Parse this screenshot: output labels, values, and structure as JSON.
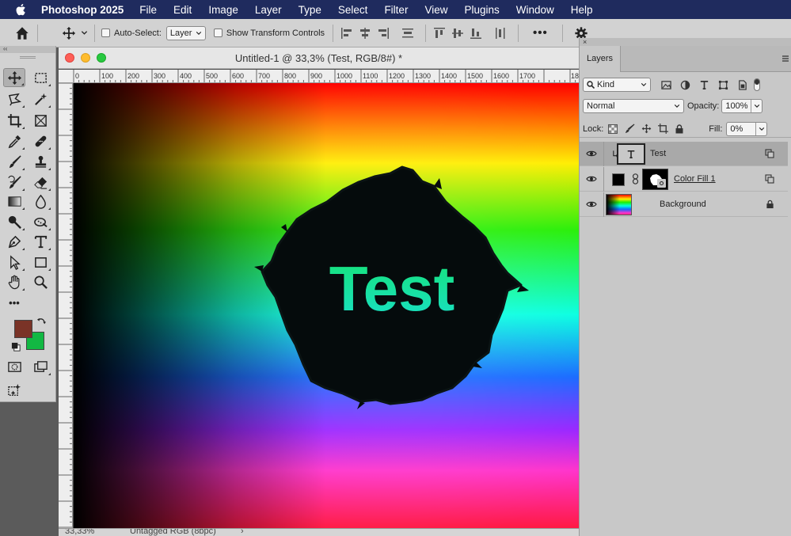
{
  "menubar": {
    "app_name": "Photoshop 2025",
    "items": [
      "File",
      "Edit",
      "Image",
      "Layer",
      "Type",
      "Select",
      "Filter",
      "View",
      "Plugins",
      "Window",
      "Help"
    ]
  },
  "options_bar": {
    "auto_select_label": "Auto-Select:",
    "auto_select_checked": false,
    "auto_select_target": "Layer",
    "show_transform_label": "Show Transform Controls",
    "show_transform_checked": false,
    "more_label": "•••"
  },
  "toolbox": {
    "collapse_label": "‹‹",
    "more_tools_label": "•••",
    "foreground_color": "#7a3327",
    "background_color": "#12b843"
  },
  "document": {
    "title": "Untitled-1 @ 33,3% (Test, RGB/8#) *",
    "zoom": "33,33%",
    "color_profile": "Untagged RGB (8bpc)",
    "status_arrow": "›",
    "canvas_text": "Test",
    "ruler_ticks": [
      "0",
      "100",
      "200",
      "300",
      "400",
      "500",
      "600",
      "700",
      "800",
      "900",
      "1000",
      "1100",
      "1200",
      "1300",
      "1400",
      "1500",
      "1600",
      "1700",
      "18"
    ]
  },
  "layers_panel": {
    "tab_label": "Layers",
    "filter_kind": "Kind",
    "blend_mode": "Normal",
    "opacity_label": "Opacity:",
    "opacity_value": "100%",
    "lock_label": "Lock:",
    "fill_label": "Fill:",
    "fill_value": "0%",
    "layers": [
      {
        "name": "Test",
        "type": "text",
        "selected": true,
        "visible": true,
        "clipped": true
      },
      {
        "name": "Color Fill 1",
        "type": "fill",
        "selected": false,
        "visible": true,
        "masked": true
      },
      {
        "name": "Background",
        "type": "pixel",
        "selected": false,
        "visible": true,
        "locked": true
      }
    ]
  },
  "colors": {
    "menubar_bg": "#1f2b5e",
    "text_fill_top": "#16e274",
    "text_fill_bottom": "#19e0c8"
  }
}
